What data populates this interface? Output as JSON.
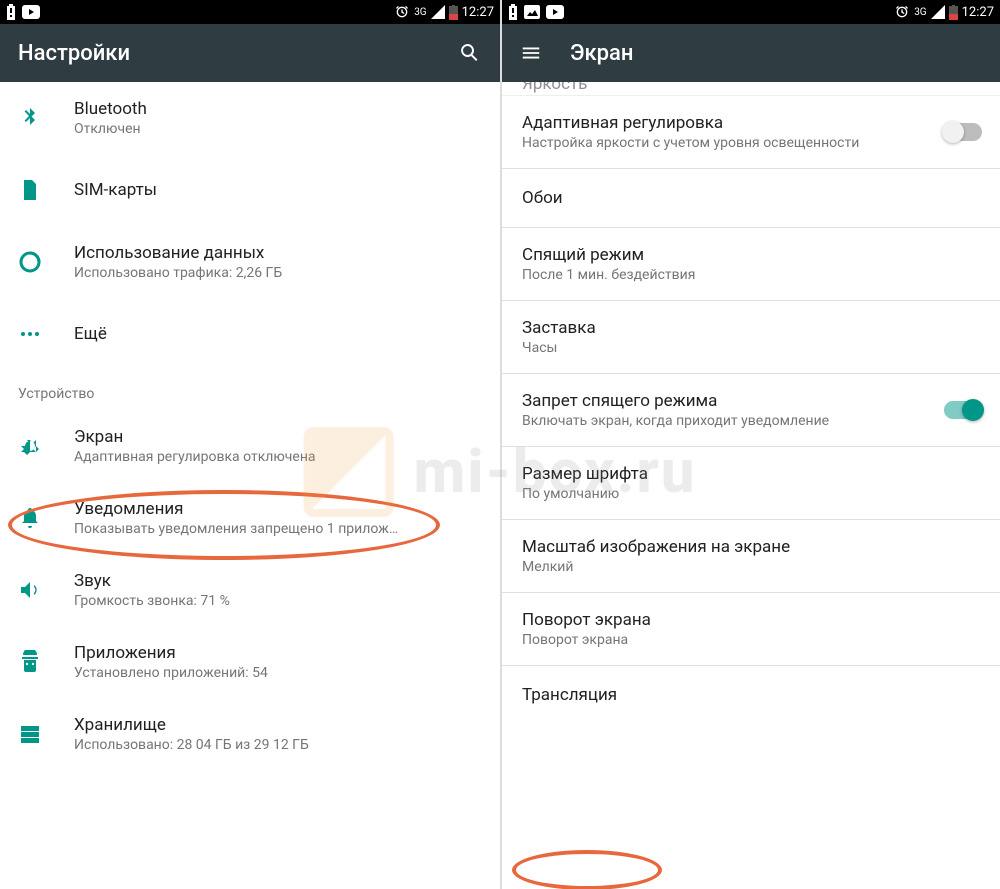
{
  "status": {
    "time": "12:27",
    "network_label": "3G"
  },
  "left": {
    "app_title": "Настройки",
    "items": [
      {
        "title": "Bluetooth",
        "sub": "Отключен",
        "icon": "bluetooth"
      },
      {
        "title": "SIM-карты",
        "sub": "",
        "icon": "sim"
      },
      {
        "title": "Использование данных",
        "sub": "Использовано трафика: 2,26 ГБ",
        "icon": "data"
      },
      {
        "title": "Ещё",
        "sub": "",
        "icon": "more"
      }
    ],
    "section": "Устройство",
    "device_items": [
      {
        "title": "Экран",
        "sub": "Адаптивная регулировка отключена",
        "icon": "brightness"
      },
      {
        "title": "Уведомления",
        "sub": "Показывать уведомления запрещено 1 прилож…",
        "icon": "bell"
      },
      {
        "title": "Звук",
        "sub": "Громкость звонка: 71 %",
        "icon": "sound"
      },
      {
        "title": "Приложения",
        "sub": "Установлено приложений: 54",
        "icon": "apps"
      },
      {
        "title": "Хранилище",
        "sub": "Использовано: 28 04 ГБ из 29 12 ГБ",
        "icon": "storage"
      }
    ]
  },
  "right": {
    "app_title": "Экран",
    "partial_top": "Яркость",
    "items": [
      {
        "title": "Адаптивная регулировка",
        "sub": "Настройка яркости с учетом уровня освещенности",
        "switch": "off"
      },
      {
        "title": "Обои",
        "sub": ""
      },
      {
        "title": "Спящий режим",
        "sub": "После 1 мин. бездействия"
      },
      {
        "title": "Заставка",
        "sub": "Часы"
      },
      {
        "title": "Запрет спящего режима",
        "sub": "Включать экран, когда приходит уведомление",
        "switch": "on"
      },
      {
        "title": "Размер шрифта",
        "sub": "По умолчанию"
      },
      {
        "title": "Масштаб изображения на экране",
        "sub": "Мелкий"
      },
      {
        "title": "Поворот экрана",
        "sub": "Поворот экрана"
      },
      {
        "title": "Трансляция",
        "sub": ""
      }
    ]
  },
  "watermark": "mi-box.ru"
}
